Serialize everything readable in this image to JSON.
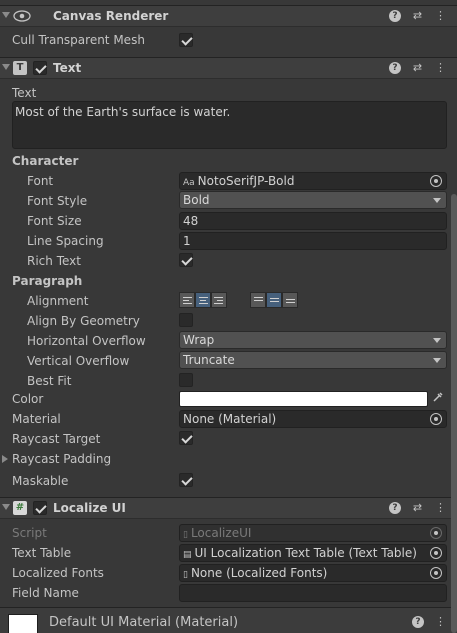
{
  "canvas_renderer": {
    "title": "Canvas Renderer",
    "cull_label": "Cull Transparent Mesh",
    "cull_checked": true
  },
  "text_component": {
    "title": "Text",
    "enabled": true,
    "text_label": "Text",
    "text_value": "Most of the Earth's surface is water.",
    "character_section": "Character",
    "font_label": "Font",
    "font_value": "NotoSerifJP-Bold",
    "font_icon": "Aa",
    "font_style_label": "Font Style",
    "font_style_value": "Bold",
    "font_size_label": "Font Size",
    "font_size_value": "48",
    "line_spacing_label": "Line Spacing",
    "line_spacing_value": "1",
    "rich_text_label": "Rich Text",
    "rich_text_checked": true,
    "paragraph_section": "Paragraph",
    "alignment_label": "Alignment",
    "align_geometry_label": "Align By Geometry",
    "align_geometry_checked": false,
    "h_overflow_label": "Horizontal Overflow",
    "h_overflow_value": "Wrap",
    "v_overflow_label": "Vertical Overflow",
    "v_overflow_value": "Truncate",
    "best_fit_label": "Best Fit",
    "best_fit_checked": false,
    "color_label": "Color",
    "color_value": "#ffffff",
    "material_label": "Material",
    "material_value": "None (Material)",
    "raycast_target_label": "Raycast Target",
    "raycast_target_checked": true,
    "raycast_padding_label": "Raycast Padding",
    "maskable_label": "Maskable",
    "maskable_checked": true
  },
  "localize_ui": {
    "title": "Localize UI",
    "enabled": true,
    "script_label": "Script",
    "script_value": "LocalizeUI",
    "text_table_label": "Text Table",
    "text_table_value": "UI Localization Text Table (Text Table)",
    "localized_fonts_label": "Localized Fonts",
    "localized_fonts_value": "None (Localized Fonts)",
    "field_name_label": "Field Name",
    "field_name_value": ""
  },
  "footer": {
    "material_name": "Default UI Material (Material)"
  },
  "colors": {
    "background": "#383838",
    "header": "#3e3e3e",
    "field": "#2a2a2a",
    "selected_button": "#46607c"
  }
}
